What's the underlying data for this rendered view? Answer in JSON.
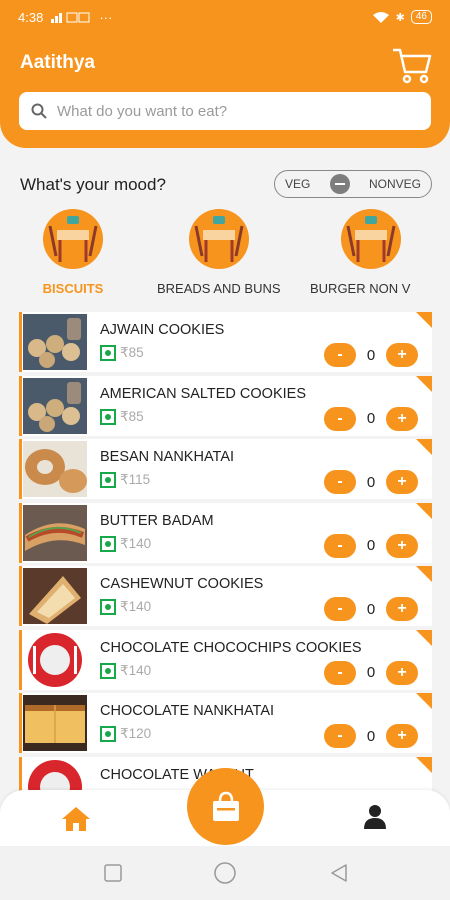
{
  "status_bar": {
    "time": "4:38",
    "battery": "46"
  },
  "header": {
    "title": "Aatithya"
  },
  "search": {
    "placeholder": "What do you want to eat?"
  },
  "mood": {
    "title": "What's your mood?",
    "veg_label": "VEG",
    "nonveg_label": "NONVEG"
  },
  "categories": [
    {
      "label": "BISCUITS",
      "active": true
    },
    {
      "label": "BREADS AND BUNS",
      "active": false
    },
    {
      "label": "BURGER NON V",
      "active": false
    }
  ],
  "items": [
    {
      "name": "AJWAIN COOKIES",
      "price": "₹85",
      "qty": "0",
      "minus": "-",
      "plus": "+"
    },
    {
      "name": "AMERICAN SALTED COOKIES",
      "price": "₹85",
      "qty": "0",
      "minus": "-",
      "plus": "+"
    },
    {
      "name": "BESAN NANKHATAI",
      "price": "₹115",
      "qty": "0",
      "minus": "-",
      "plus": "+"
    },
    {
      "name": "BUTTER BADAM",
      "price": "₹140",
      "qty": "0",
      "minus": "-",
      "plus": "+"
    },
    {
      "name": "CASHEWNUT COOKIES",
      "price": "₹140",
      "qty": "0",
      "minus": "-",
      "plus": "+"
    },
    {
      "name": "CHOCOLATE CHOCOCHIPS COOKIES",
      "price": "₹140",
      "qty": "0",
      "minus": "-",
      "plus": "+"
    },
    {
      "name": "CHOCOLATE NANKHATAI",
      "price": "₹120",
      "qty": "0",
      "minus": "-",
      "plus": "+"
    },
    {
      "name": "CHOCOLATE WALNUT",
      "price": "",
      "qty": "",
      "minus": "",
      "plus": ""
    }
  ],
  "colors": {
    "accent": "#f7941d",
    "veg": "#17a84a"
  },
  "icons": {
    "cart": "cart-icon",
    "search": "search-icon",
    "home": "home-icon",
    "bag": "shopping-bag-icon",
    "profile": "user-icon"
  }
}
